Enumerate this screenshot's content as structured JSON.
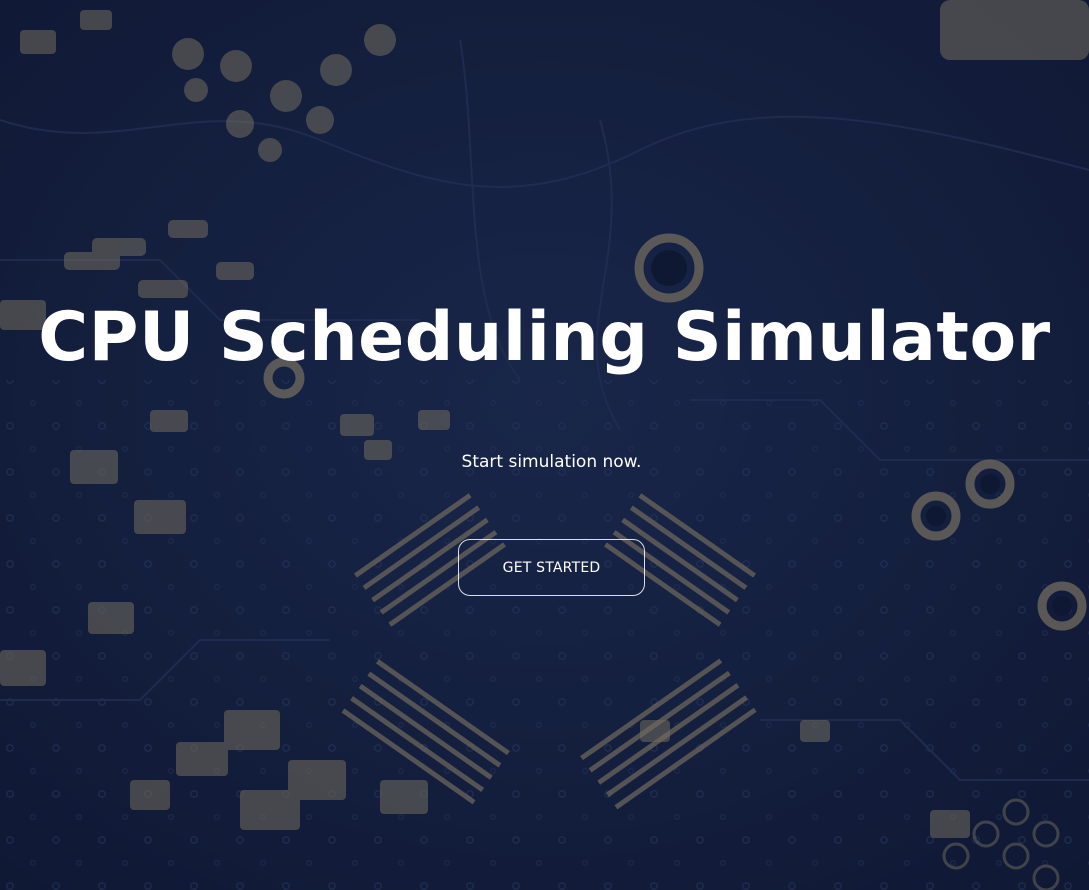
{
  "hero": {
    "title": "CPU Scheduling Simulator",
    "subtitle": "Start simulation now.",
    "cta_label": "GET STARTED"
  },
  "colors": {
    "background": "#18264a",
    "text": "#ffffff",
    "pad": "#a89a78",
    "trace": "#2a3a63"
  }
}
